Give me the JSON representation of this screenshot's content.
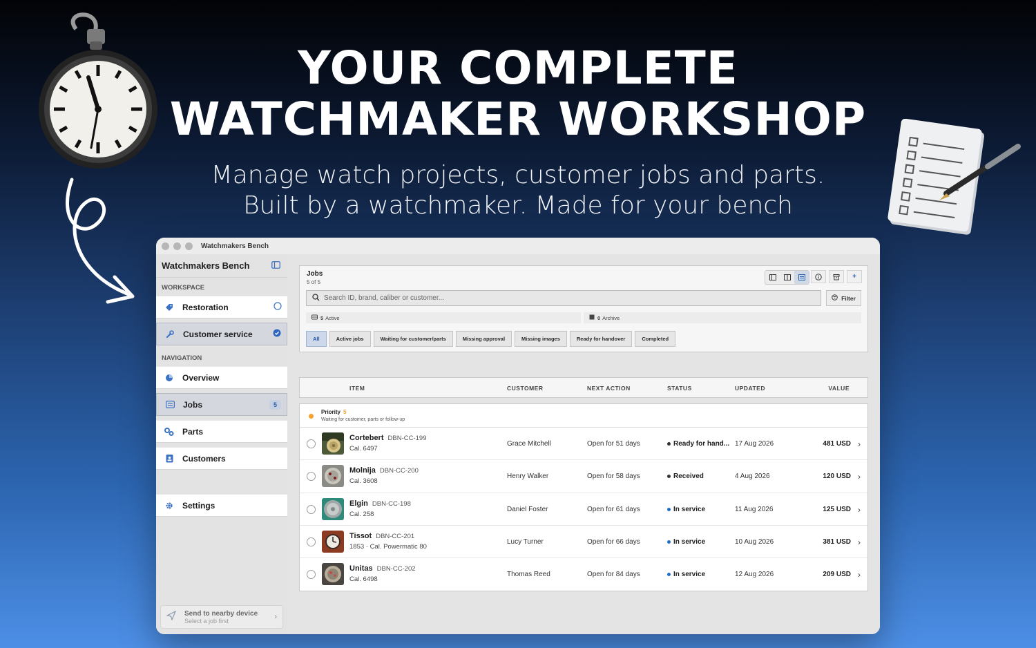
{
  "hero": {
    "title_line1": "YOUR COMPLETE",
    "title_line2": "WATCHMAKER WORKSHOP",
    "subtitle_line1": "Manage watch projects, customer jobs and parts.",
    "subtitle_line2": "Built by a watchmaker. Made for your bench"
  },
  "window": {
    "title": "Watchmakers Bench"
  },
  "sidebar": {
    "app_name": "Watchmakers Bench",
    "workspace_label": "WORKSPACE",
    "workspace_items": [
      {
        "label": "Restoration",
        "icon": "tag-icon",
        "checked": false
      },
      {
        "label": "Customer service",
        "icon": "wrench-icon",
        "checked": true
      }
    ],
    "navigation_label": "NAVIGATION",
    "nav_items": [
      {
        "label": "Overview",
        "icon": "pie-chart-icon"
      },
      {
        "label": "Jobs",
        "icon": "list-icon",
        "badge": "5",
        "selected": true
      },
      {
        "label": "Parts",
        "icon": "gears-icon"
      },
      {
        "label": "Customers",
        "icon": "contacts-icon"
      }
    ],
    "settings_label": "Settings",
    "send": {
      "title": "Send to nearby device",
      "subtitle": "Select a job first"
    }
  },
  "jobs": {
    "title": "Jobs",
    "count": "5 of 5",
    "search_placeholder": "Search ID, brand, caliber or customer...",
    "filter_label": "Filter",
    "active_count": "5",
    "active_label": "Active",
    "archive_count": "0",
    "archive_label": "Archive",
    "chips": [
      "All",
      "Active jobs",
      "Waiting for customer/parts",
      "Missing approval",
      "Missing images",
      "Ready for handover",
      "Completed"
    ],
    "selected_chip": "All"
  },
  "table": {
    "columns": [
      "ITEM",
      "CUSTOMER",
      "NEXT ACTION",
      "STATUS",
      "UPDATED",
      "VALUE"
    ],
    "priority": {
      "title": "Priority",
      "count": "5",
      "subtitle": "Waiting for customer, parts or follow-up"
    },
    "rows": [
      {
        "brand": "Cortebert",
        "code": "DBN-CC-199",
        "caliber": "Cal. 6497",
        "customer": "Grace Mitchell",
        "next_action": "Open for 51 days",
        "status": "Ready for hand...",
        "status_color": "#333333",
        "updated": "17 Aug 2026",
        "value": "481 USD"
      },
      {
        "brand": "Molnija",
        "code": "DBN-CC-200",
        "caliber": "Cal. 3608",
        "customer": "Henry Walker",
        "next_action": "Open for 58 days",
        "status": "Received",
        "status_color": "#333333",
        "updated": "4 Aug 2026",
        "value": "120 USD"
      },
      {
        "brand": "Elgin",
        "code": "DBN-CC-198",
        "caliber": "Cal. 258",
        "customer": "Daniel Foster",
        "next_action": "Open for 61 days",
        "status": "In service",
        "status_color": "#1f6fc9",
        "updated": "11 Aug 2026",
        "value": "125 USD"
      },
      {
        "brand": "Tissot",
        "code": "DBN-CC-201",
        "caliber": "1853 · Cal. Powermatic 80",
        "customer": "Lucy Turner",
        "next_action": "Open for 66 days",
        "status": "In service",
        "status_color": "#1f6fc9",
        "updated": "10 Aug 2026",
        "value": "381 USD"
      },
      {
        "brand": "Unitas",
        "code": "DBN-CC-202",
        "caliber": "Cal. 6498",
        "customer": "Thomas Reed",
        "next_action": "Open for 84 days",
        "status": "In service",
        "status_color": "#1f6fc9",
        "updated": "12 Aug 2026",
        "value": "209 USD"
      }
    ]
  }
}
